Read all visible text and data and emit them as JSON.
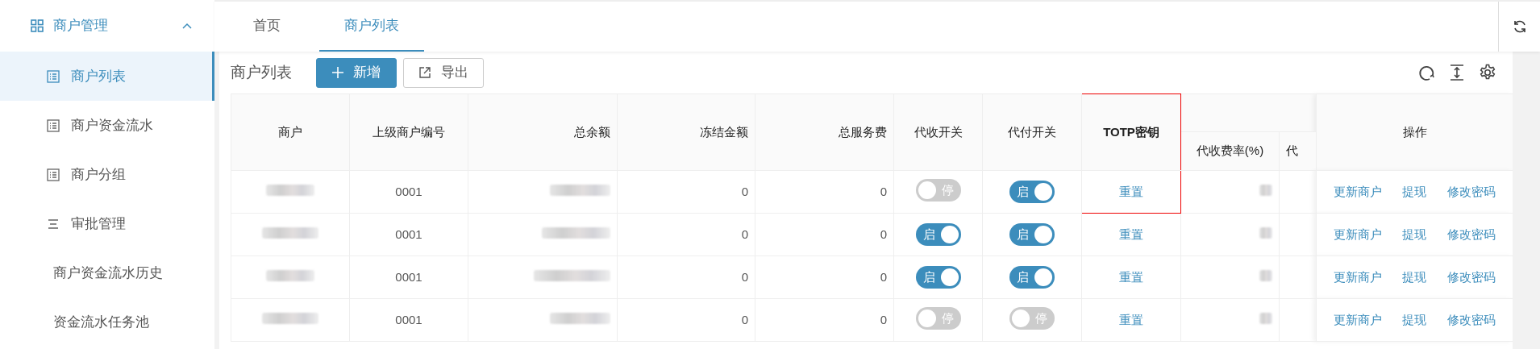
{
  "sidebar": {
    "groups": [
      {
        "label": "商户管理",
        "expanded": true,
        "children": [
          {
            "label": "商户列表",
            "kind": "list",
            "selected": true
          },
          {
            "label": "商户资金流水",
            "kind": "list",
            "selected": false
          },
          {
            "label": "商户分组",
            "kind": "list",
            "selected": false
          },
          {
            "label": "审批管理",
            "kind": "menu",
            "selected": false,
            "children": [
              {
                "label": "商户资金流水历史",
                "selected": false
              },
              {
                "label": "资金流水任务池",
                "selected": false
              }
            ]
          }
        ]
      }
    ]
  },
  "tabs": [
    {
      "label": "首页",
      "selected": false
    },
    {
      "label": "商户列表",
      "selected": true
    }
  ],
  "toolbar": {
    "title": "商户列表",
    "buttons": [
      {
        "label": "新增",
        "kind": "primary"
      },
      {
        "label": "导出",
        "kind": "export"
      }
    ]
  },
  "table": {
    "columns": [
      {
        "label": "商户"
      },
      {
        "label": "上级商户编号"
      },
      {
        "label": "总余额"
      },
      {
        "label": "冻结金额"
      },
      {
        "label": "总服务费"
      },
      {
        "label": "代收开关"
      },
      {
        "label": "代付开关"
      },
      {
        "label": "TOTP密钥",
        "highlighted": true
      },
      {
        "kind": "group",
        "children": [
          {
            "label": "代收费率(%)"
          },
          {
            "label": "代"
          }
        ]
      },
      {
        "label": "操作"
      }
    ],
    "rows": [
      {
        "merchant_redacted": true,
        "parent": "0001",
        "balance_redacted": true,
        "frozen": "0",
        "fee": "0",
        "collect": {
          "on": false,
          "label": "停"
        },
        "pay": {
          "on": true,
          "label": "启"
        },
        "totp": "重置",
        "rate_redacted": true,
        "actions": [
          "更新商户",
          "提现",
          "修改密码"
        ]
      },
      {
        "merchant_redacted": true,
        "parent": "0001",
        "balance_redacted": true,
        "frozen": "0",
        "fee": "0",
        "collect": {
          "on": true,
          "label": "启"
        },
        "pay": {
          "on": true,
          "label": "启"
        },
        "totp": "重置",
        "rate_redacted": true,
        "actions": [
          "更新商户",
          "提现",
          "修改密码"
        ]
      },
      {
        "merchant_redacted": true,
        "parent": "0001",
        "balance_redacted": true,
        "frozen": "0",
        "fee": "0",
        "collect": {
          "on": true,
          "label": "启"
        },
        "pay": {
          "on": true,
          "label": "启"
        },
        "totp": "重置",
        "rate_redacted": true,
        "actions": [
          "更新商户",
          "提现",
          "修改密码"
        ]
      },
      {
        "merchant_redacted": true,
        "parent": "0001",
        "balance_redacted": true,
        "frozen": "0",
        "fee": "0",
        "collect": {
          "on": false,
          "label": "停"
        },
        "pay": {
          "on": false,
          "label": "停"
        },
        "totp": "重置",
        "rate_redacted": true,
        "actions": [
          "更新商户",
          "提现",
          "修改密码"
        ]
      }
    ]
  }
}
